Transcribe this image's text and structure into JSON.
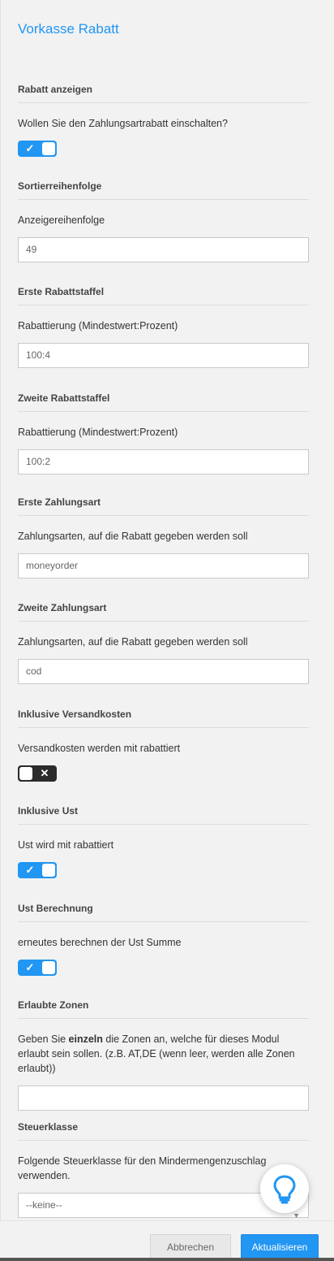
{
  "title": "Vorkasse Rabatt",
  "sections": [
    {
      "heading": "Rabatt anzeigen",
      "label": "Wollen Sie den Zahlungsartrabatt einschalten?",
      "toggle": "on",
      "toggle_mark": "✓"
    },
    {
      "heading": "Sortierreihenfolge",
      "label": "Anzeigereihenfolge",
      "value": "49"
    },
    {
      "heading": "Erste Rabattstaffel",
      "label": "Rabattierung (Mindestwert:Prozent)",
      "value": "100:4"
    },
    {
      "heading": "Zweite Rabattstaffel",
      "label": "Rabattierung (Mindestwert:Prozent)",
      "value": "100:2"
    },
    {
      "heading": "Erste Zahlungsart",
      "label": "Zahlungsarten, auf die Rabatt gegeben werden soll",
      "value": "moneyorder"
    },
    {
      "heading": "Zweite Zahlungsart",
      "label": "Zahlungsarten, auf die Rabatt gegeben werden soll",
      "value": "cod"
    },
    {
      "heading": "Inklusive Versandkosten",
      "label": "Versandkosten werden mit rabattiert",
      "toggle": "off",
      "toggle_mark": "✕"
    },
    {
      "heading": "Inklusive Ust",
      "label": "Ust wird mit rabattiert",
      "toggle": "on",
      "toggle_mark": "✓"
    },
    {
      "heading": "Ust Berechnung",
      "label": "erneutes berechnen der Ust Summe",
      "toggle": "on",
      "toggle_mark": "✓"
    },
    {
      "heading": "Erlaubte Zonen",
      "label_pre": "Geben Sie ",
      "label_bold": "einzeln",
      "label_post": " die Zonen an, welche für dieses Modul erlaubt sein sollen. (z.B. AT,DE (wenn leer, werden alle Zonen erlaubt))",
      "value": ""
    },
    {
      "heading": "Steuerklasse",
      "label": "Folgende Steuerklasse für den Mindermengenzuschlag verwenden.",
      "select_value": "--keine--"
    }
  ],
  "buttons": {
    "cancel": "Abbrechen",
    "update": "Aktualisieren"
  },
  "help_icon": "lightbulb-icon",
  "colors": {
    "accent": "#2196f3",
    "toggle_off": "#2b2b2b"
  }
}
